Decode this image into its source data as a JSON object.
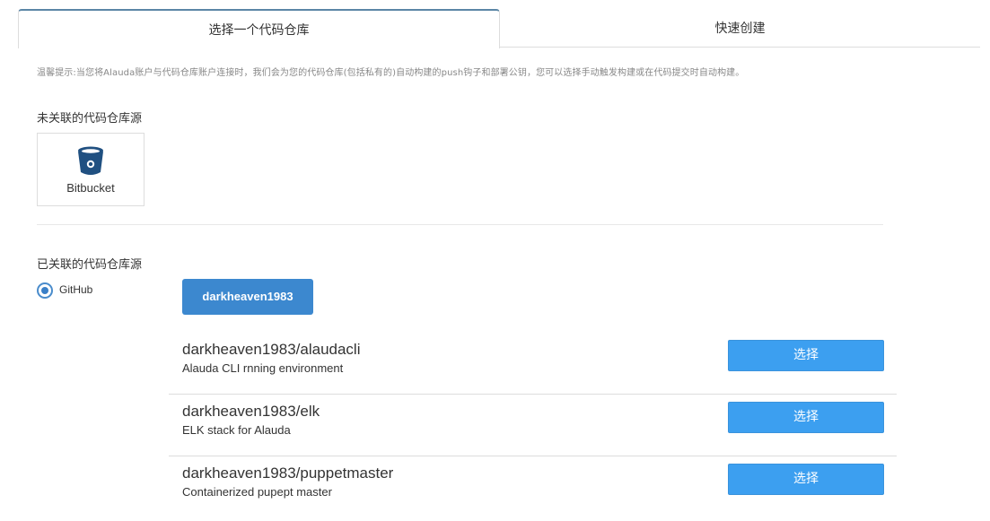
{
  "tabs": [
    {
      "label": "选择一个代码仓库",
      "active": true
    },
    {
      "label": "快速创建",
      "active": false
    }
  ],
  "hint": "温馨提示:当您将Alauda账户与代码仓库账户连接时，我们会为您的代码仓库(包括私有的)自动构建的push钩子和部署公钥，您可以选择手动触发构建或在代码提交时自动构建。",
  "unlinked": {
    "title": "未关联的代码仓库源",
    "providers": [
      {
        "label": "Bitbucket",
        "icon": "bitbucket-icon"
      }
    ]
  },
  "linked": {
    "title": "已关联的代码仓库源",
    "source": {
      "label": "GitHub",
      "selected": true
    },
    "account": "darkheaven1983"
  },
  "repos": [
    {
      "name": "darkheaven1983/alaudacli",
      "description": "Alauda CLI rnning environment",
      "button": "选择"
    },
    {
      "name": "darkheaven1983/elk",
      "description": "ELK stack for Alauda",
      "button": "选择"
    },
    {
      "name": "darkheaven1983/puppetmaster",
      "description": "Containerized pupept master",
      "button": "选择"
    }
  ],
  "colors": {
    "primary": "#3c88cf",
    "select_button": "#3c9ff0",
    "bitbucket_brand": "#205081"
  }
}
